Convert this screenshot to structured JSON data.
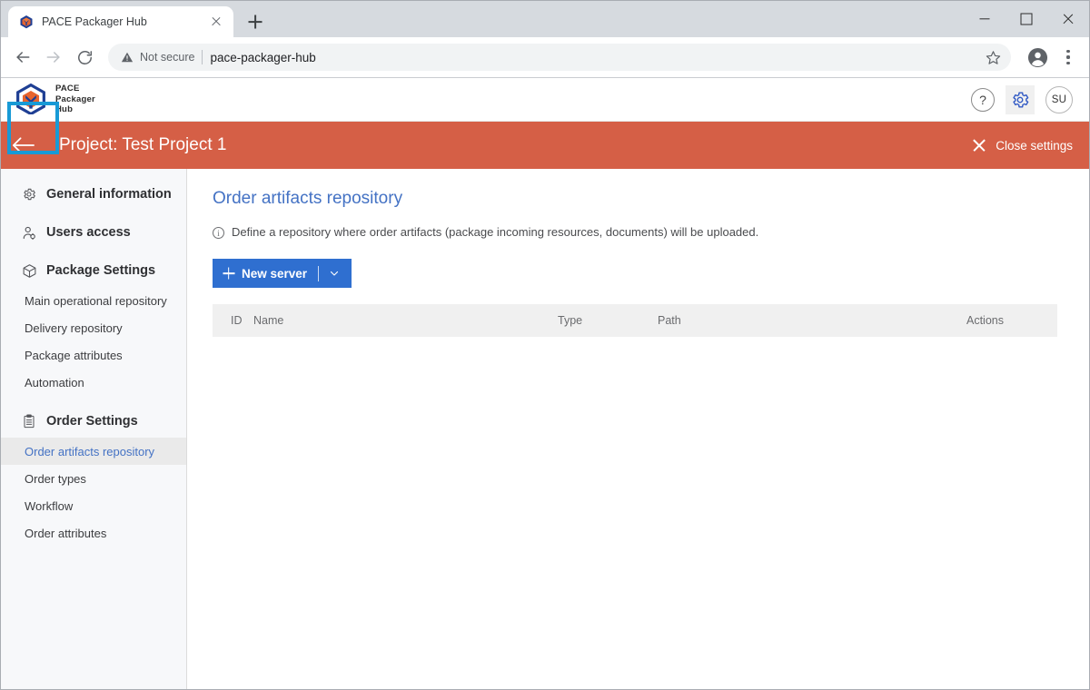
{
  "browser": {
    "tab": {
      "title": "PACE Packager Hub",
      "favicon_icon": "pace-cube-favicon",
      "close_icon": "close-icon"
    },
    "new_tab_icon": "plus-icon",
    "window_controls": {
      "minimize_icon": "minimize-icon",
      "maximize_icon": "maximize-icon",
      "close_icon": "close-icon"
    },
    "nav": {
      "back_icon": "arrow-left-icon",
      "forward_icon": "arrow-right-icon",
      "reload_icon": "reload-icon"
    },
    "omnibox": {
      "security_label": "Not secure",
      "security_icon": "warning-triangle-icon",
      "url": "pace-packager-hub",
      "bookmark_icon": "star-icon",
      "profile_icon": "account-circle-icon",
      "menu_icon": "three-dot-menu-icon"
    }
  },
  "app_header": {
    "logo_icon": "pace-cube-logo",
    "brand_line1": "PACE",
    "brand_line2": "Packager",
    "brand_line3": "Hub",
    "help_label": "?",
    "help_icon": "help-icon",
    "settings_icon": "gear-icon",
    "avatar_initials": "SU"
  },
  "project_bar": {
    "back_icon": "arrow-left-icon",
    "title": "Project: Test Project 1",
    "close_settings_label": "Close settings",
    "close_icon": "close-icon",
    "background_color": "#d55f46",
    "highlight_color": "#189ad6"
  },
  "sidebar": {
    "groups": [
      {
        "label": "General information",
        "icon": "gear-icon",
        "items": []
      },
      {
        "label": "Users access",
        "icon": "user-access-icon",
        "items": []
      },
      {
        "label": "Package Settings",
        "icon": "package-cube-icon",
        "items": [
          "Main operational repository",
          "Delivery repository",
          "Package attributes",
          "Automation"
        ]
      },
      {
        "label": "Order Settings",
        "icon": "clipboard-icon",
        "items": [
          "Order artifacts repository",
          "Order types",
          "Workflow",
          "Order attributes"
        ]
      }
    ],
    "active_item": "Order artifacts repository",
    "active_color": "#4472c4"
  },
  "main": {
    "title": "Order artifacts repository",
    "title_color": "#4472c4",
    "hint_icon": "info-icon",
    "hint": "Define a repository where order artifacts (package incoming resources, documents) will be uploaded.",
    "new_server_button": {
      "label": "New server",
      "plus_icon": "plus-icon",
      "caret_icon": "chevron-down-icon",
      "color": "#2f6fd0"
    },
    "table": {
      "columns": [
        "ID",
        "Name",
        "Type",
        "Path",
        "Actions"
      ],
      "rows": []
    }
  }
}
